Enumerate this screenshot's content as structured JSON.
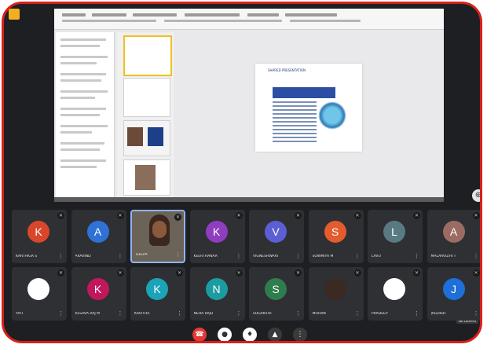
{
  "colors": {
    "frame": "#d8201c",
    "background": "#1e1f22",
    "tile": "#2f3033",
    "end_call": "#e53935"
  },
  "slide": {
    "title": "SHARED PRESENTATION"
  },
  "participants": [
    {
      "initial": "K",
      "name": "KARTHIGA S",
      "color": "#d9472b"
    },
    {
      "initial": "A",
      "name": "Aravind",
      "color": "#2f72d6"
    },
    {
      "initial": "",
      "name": "Deepa",
      "color": "",
      "video": true
    },
    {
      "initial": "K",
      "name": "KEERTHANAA",
      "color": "#8e3dbf"
    },
    {
      "initial": "V",
      "name": "VIGNESHWARI",
      "color": "#5c5fd3"
    },
    {
      "initial": "S",
      "name": "SOWMIYA M",
      "color": "#e45b2e"
    },
    {
      "initial": "L",
      "name": "Lavu",
      "color": "#5a7a83"
    },
    {
      "initial": "A",
      "name": "MALARVIZHI T",
      "color": "#9c6c62"
    },
    {
      "initial": "",
      "name": "Yati",
      "color": "#ffffff",
      "picture": true
    },
    {
      "initial": "K",
      "name": "KESAVA RAJ M",
      "color": "#c2185b"
    },
    {
      "initial": "K",
      "name": "Kavitha",
      "color": "#1ba3b7"
    },
    {
      "initial": "N",
      "name": "NEHA RAJU",
      "color": "#1b9ca0"
    },
    {
      "initial": "S",
      "name": "SUGANTHI",
      "color": "#2e7d4e"
    },
    {
      "initial": "",
      "name": "Mohan",
      "color": "#3b2a22",
      "picture": true
    },
    {
      "initial": "",
      "name": "Pradeep",
      "color": "#ffffff",
      "picture": true
    },
    {
      "initial": "J",
      "name": "JAGDISH",
      "color": "#1e6fd9"
    }
  ],
  "tooltip": "No camera",
  "controls": {
    "end_call": "end-call",
    "camera": "camera",
    "mic": "microphone",
    "present": "present",
    "more": "more"
  }
}
